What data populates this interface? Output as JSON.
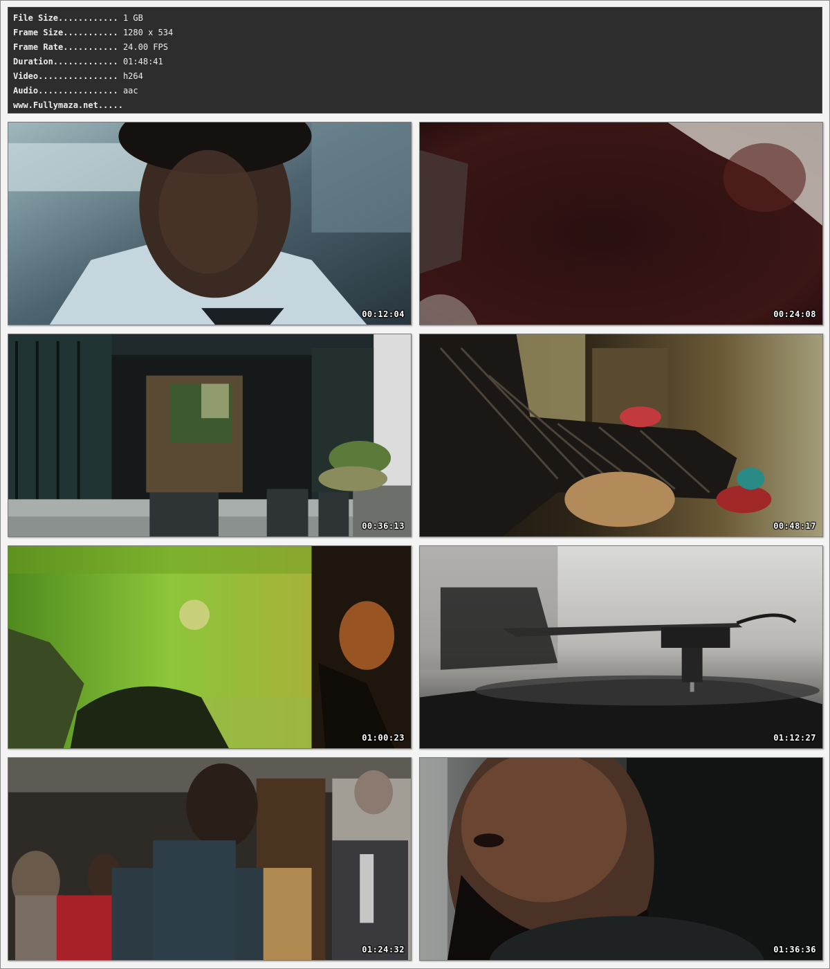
{
  "info": {
    "lines": [
      {
        "label": "File Size............",
        "value": " 1 GB"
      },
      {
        "label": "Frame Size...........",
        "value": " 1280 x 534"
      },
      {
        "label": "Frame Rate...........",
        "value": " 24.00 FPS"
      },
      {
        "label": "Duration.............",
        "value": " 01:48:41"
      },
      {
        "label": "Video................",
        "value": " h264"
      },
      {
        "label": "Audio................",
        "value": " aac"
      },
      {
        "label": "www.Fullymaza.net.....",
        "value": ""
      }
    ]
  },
  "frames": [
    {
      "timestamp": "00:12:04",
      "scene": "boy-in-white-shirt"
    },
    {
      "timestamp": "00:24:08",
      "scene": "dark-blurred-closeup"
    },
    {
      "timestamp": "00:36:13",
      "scene": "building-entrance"
    },
    {
      "timestamp": "00:48:17",
      "scene": "striped-sleeve-arm"
    },
    {
      "timestamp": "01:00:23",
      "scene": "green-wall-room"
    },
    {
      "timestamp": "01:12:27",
      "scene": "record-turntable"
    },
    {
      "timestamp": "01:24:32",
      "scene": "crowd-scene"
    },
    {
      "timestamp": "01:36:36",
      "scene": "bearded-man-closeup"
    }
  ]
}
